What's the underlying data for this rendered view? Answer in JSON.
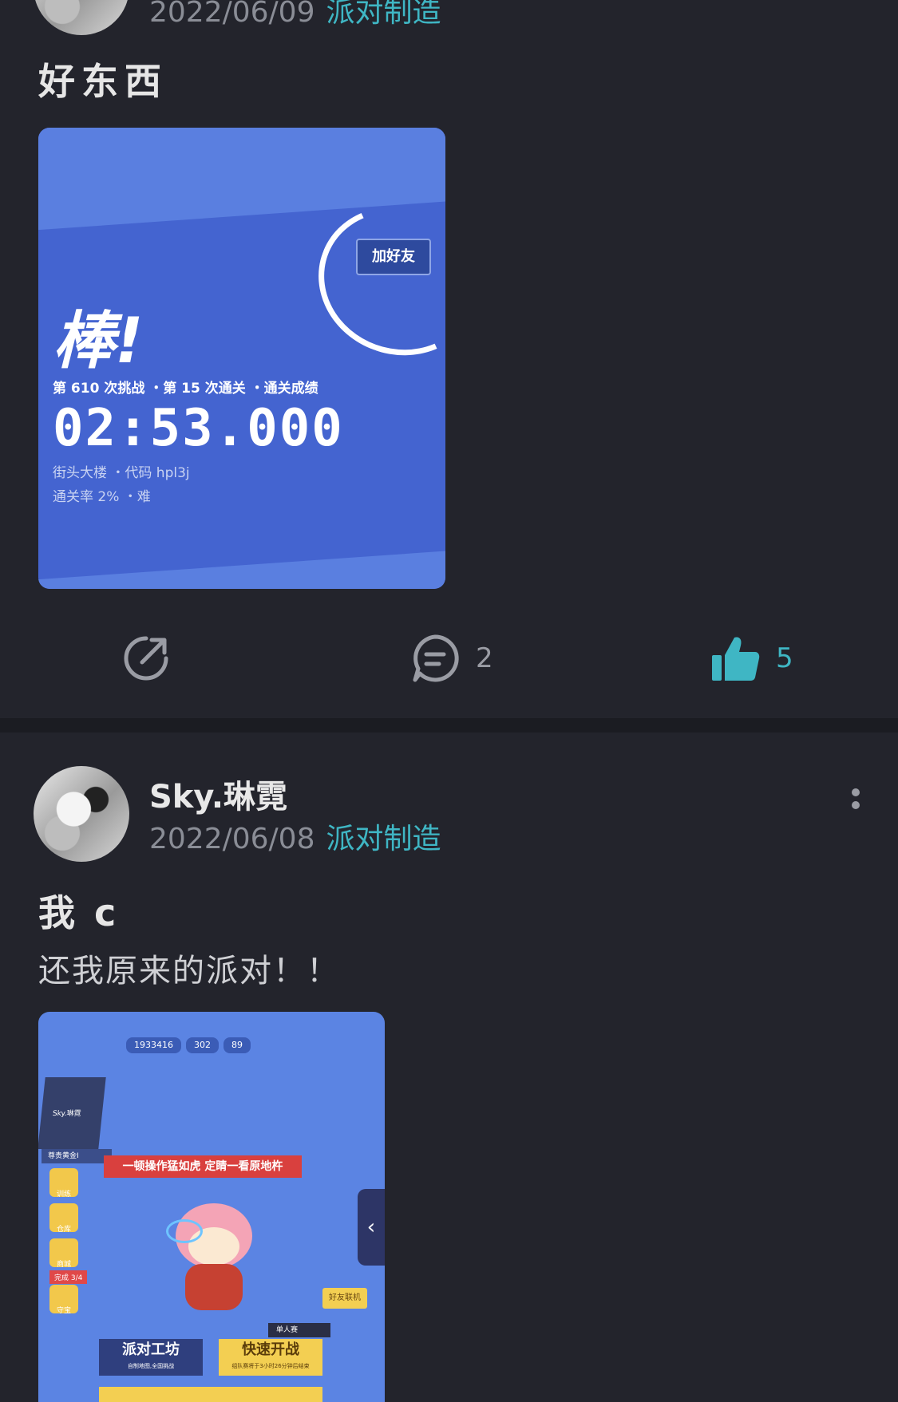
{
  "post1": {
    "date": "2022/06/09",
    "topic": "派对制造",
    "title": "好东西",
    "screenshot": {
      "add_friend": "加好友",
      "bang": "棒!",
      "stats": "第 610 次挑战 ・第 15 次通关 ・通关成绩",
      "time": "02:53.000",
      "level_line1": "街头大楼 ・代码 hpl3j",
      "level_line2": "通关率 2% ・难"
    },
    "actions": {
      "comment_count": "2",
      "like_count": "5"
    }
  },
  "post2": {
    "username": "Sky.琳霓",
    "date": "2022/06/08",
    "topic": "派对制造",
    "title": "我 c",
    "body": "还我原来的派对！！",
    "screenshot": {
      "coins": "1933416",
      "gems": "302",
      "tickets": "89",
      "player_name": "Sky.琳霓",
      "rank": "尊贵黄金I",
      "banner": "一顿操作猛如虎 定睛一看原地杵",
      "menu_train": "训练",
      "menu_warehouse": "仓库",
      "menu_shop": "商城",
      "menu_guard": "守宝",
      "done": "完成 3/4",
      "friend_btn": "好友联机",
      "solo": "单人赛",
      "workshop": "派对工坊",
      "workshop_sub": "自制地图,全国挑战",
      "fast": "快速开战",
      "fast_sub": "组队赛将于3小时26分钟后结束"
    }
  },
  "colors": {
    "background": "#23242c",
    "accent": "#3fb6c4",
    "muted": "#8a8d96"
  }
}
